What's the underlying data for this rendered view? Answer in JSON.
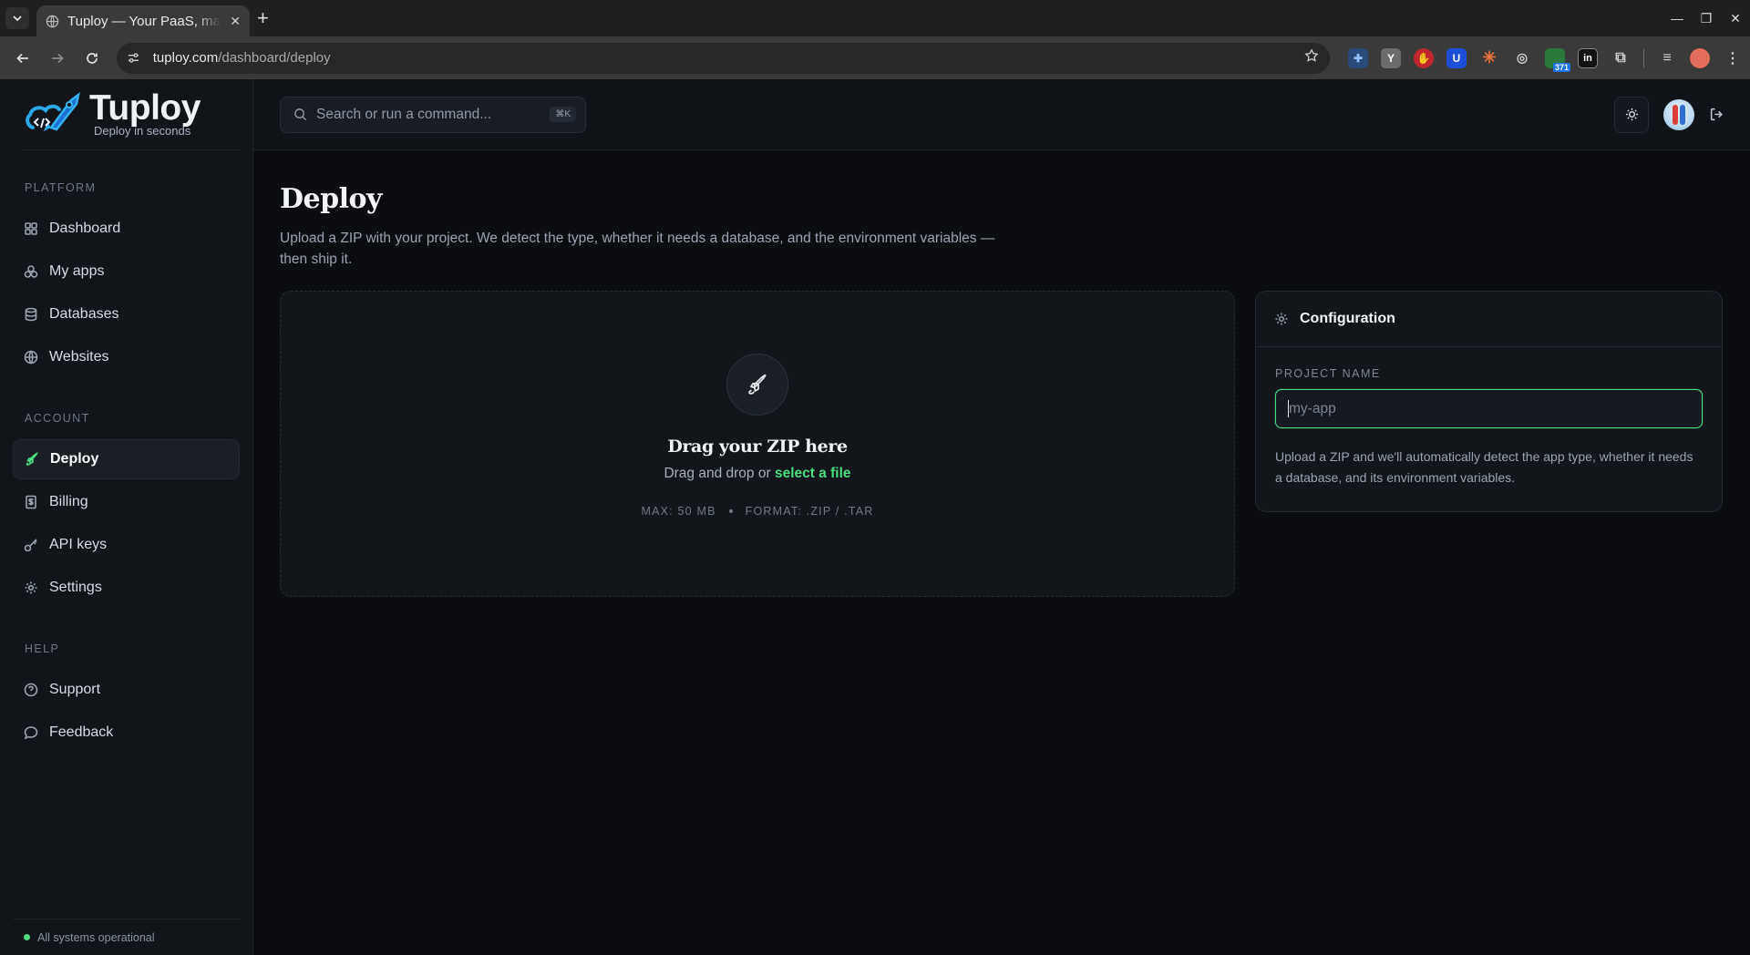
{
  "browser": {
    "tab_title": "Tuploy — Your PaaS, made simple",
    "url_host": "tuploy.com",
    "url_path": "/dashboard/deploy",
    "ext_badge": "371"
  },
  "brand": {
    "name": "Tuploy",
    "tagline": "Deploy in seconds"
  },
  "search": {
    "placeholder": "Search or run a command...",
    "shortcut": "⌘K"
  },
  "sidebar": {
    "sections": [
      {
        "title": "PLATFORM",
        "items": [
          {
            "label": "Dashboard",
            "icon": "dashboard-icon"
          },
          {
            "label": "My apps",
            "icon": "apps-icon"
          },
          {
            "label": "Databases",
            "icon": "database-icon"
          },
          {
            "label": "Websites",
            "icon": "globe-icon"
          }
        ]
      },
      {
        "title": "ACCOUNT",
        "items": [
          {
            "label": "Deploy",
            "icon": "rocket-icon",
            "active": true
          },
          {
            "label": "Billing",
            "icon": "billing-icon"
          },
          {
            "label": "API keys",
            "icon": "key-icon"
          },
          {
            "label": "Settings",
            "icon": "gear-icon"
          }
        ]
      },
      {
        "title": "HELP",
        "items": [
          {
            "label": "Support",
            "icon": "help-circle-icon"
          },
          {
            "label": "Feedback",
            "icon": "message-icon"
          }
        ]
      }
    ],
    "status_text": "All systems operational"
  },
  "page": {
    "title": "Deploy",
    "description": "Upload a ZIP with your project. We detect the type, whether it needs a database, and the environment variables — then ship it."
  },
  "dropzone": {
    "title": "Drag your ZIP here",
    "subtitle_prefix": "Drag and drop or ",
    "link_text": "select a file",
    "max_size": "MAX: 50 MB",
    "formats": "FORMAT: .ZIP / .TAR"
  },
  "config": {
    "title": "Configuration",
    "field_label": "PROJECT NAME",
    "field_value": "",
    "field_placeholder": "my-app",
    "help": "Upload a ZIP and we'll automatically detect the app type, whether it needs a database, and its environment variables."
  },
  "colors": {
    "accent": "#4ade80",
    "background": "#0b0d10",
    "sidebar": "#111419",
    "card": "#12161b"
  }
}
